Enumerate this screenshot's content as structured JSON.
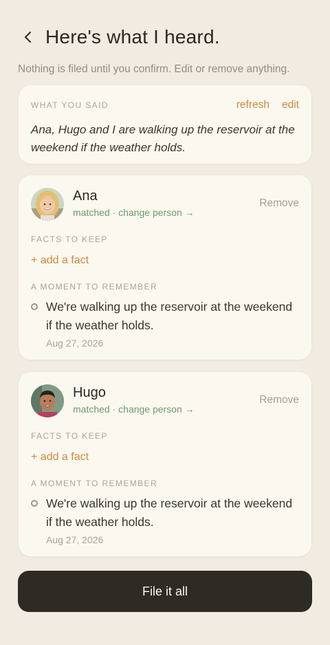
{
  "header": {
    "title": "Here's what I heard.",
    "subtitle": "Nothing is filed until you confirm. Edit or remove anything."
  },
  "said": {
    "label": "WHAT YOU SAID",
    "refresh": "refresh",
    "edit": "edit",
    "text": "Ana, Hugo and I are walking up the reservoir at the weekend if the weather holds."
  },
  "people": [
    {
      "name": "Ana",
      "matched": "matched",
      "sep": " · ",
      "change": "change person →",
      "remove": "Remove",
      "facts_label": "FACTS TO KEEP",
      "add_fact": "+ add a fact",
      "moment_label": "A MOMENT TO REMEMBER",
      "moment_text": "We're walking up the reservoir at the weekend if the weather holds.",
      "moment_date": "Aug 27, 2026"
    },
    {
      "name": "Hugo",
      "matched": "matched",
      "sep": " · ",
      "change": "change person →",
      "remove": "Remove",
      "facts_label": "FACTS TO KEEP",
      "add_fact": "+ add a fact",
      "moment_label": "A MOMENT TO REMEMBER",
      "moment_text": "We're walking up the reservoir at the weekend if the weather holds.",
      "moment_date": "Aug 27, 2026"
    }
  ],
  "footer": {
    "file_label": "File it all"
  },
  "colors": {
    "background": "#f1ebe1",
    "card": "#fbf8f0",
    "accent": "#cf8a3a",
    "matched": "#6f9a6c",
    "button": "#2e2a24"
  }
}
